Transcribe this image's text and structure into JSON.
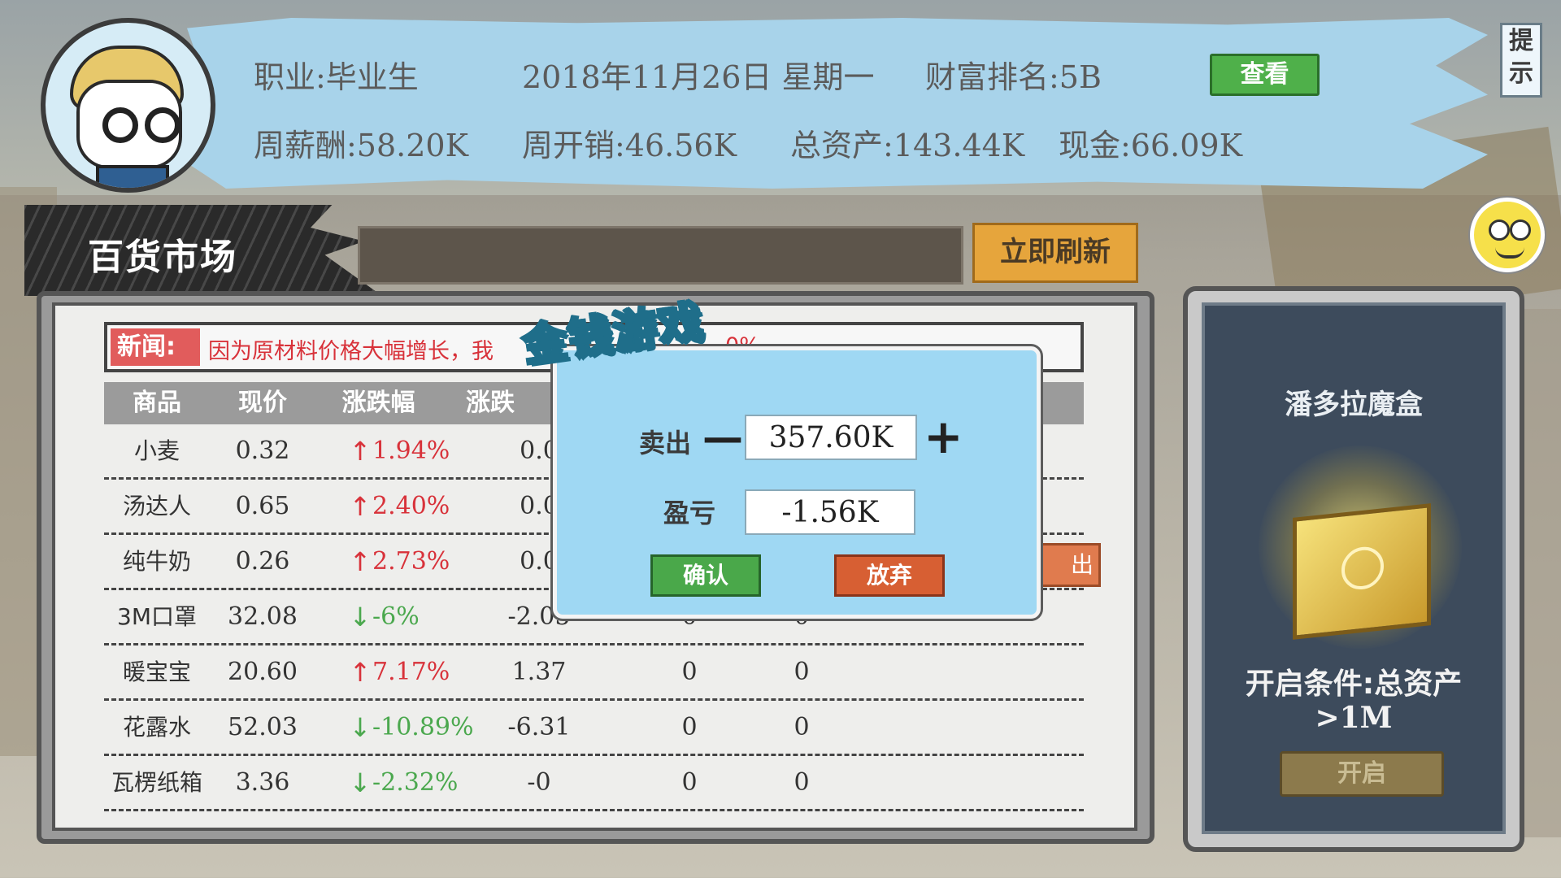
{
  "header": {
    "occupation": "职业:毕业生",
    "date": "2018年11月26日 星期一",
    "wealth_rank": "财富排名:5B",
    "view_label": "查看",
    "weekly_salary": "周薪酬:58.20K",
    "weekly_expense": "周开销:46.56K",
    "total_assets": "总资产:143.44K",
    "cash": "现金:66.09K",
    "hint_label": "提示"
  },
  "market": {
    "title": "百货市场",
    "refresh_label": "立即刷新",
    "news_tag": "新闻:",
    "news_text": "因为原材料价格大幅增长，我",
    "news_tail": "0%",
    "headers": [
      "商品",
      "现价",
      "涨跌幅",
      "涨跌"
    ],
    "rows": [
      {
        "name": "小麦",
        "price": "0.32",
        "dir": "up",
        "arrow": "↑",
        "pct": "1.94%",
        "chg": "0.0",
        "held": "",
        "cost": ""
      },
      {
        "name": "汤达人",
        "price": "0.65",
        "dir": "up",
        "arrow": "↑",
        "pct": "2.40%",
        "chg": "0.0",
        "held": "",
        "cost": ""
      },
      {
        "name": "纯牛奶",
        "price": "0.26",
        "dir": "up",
        "arrow": "↑",
        "pct": "2.73%",
        "chg": "0.0",
        "held": "",
        "cost": ""
      },
      {
        "name": "3M口罩",
        "price": "32.08",
        "dir": "down",
        "arrow": "↓",
        "pct": "-6%",
        "chg": "-2.05",
        "held": "0",
        "cost": "0"
      },
      {
        "name": "暖宝宝",
        "price": "20.60",
        "dir": "up",
        "arrow": "↑",
        "pct": "7.17%",
        "chg": "1.37",
        "held": "0",
        "cost": "0"
      },
      {
        "name": "花露水",
        "price": "52.03",
        "dir": "down",
        "arrow": "↓",
        "pct": "-10.89%",
        "chg": "-6.31",
        "held": "0",
        "cost": "0"
      },
      {
        "name": "瓦楞纸箱",
        "price": "3.36",
        "dir": "down",
        "arrow": "↓",
        "pct": "-2.32%",
        "chg": "-0",
        "held": "0",
        "cost": "0"
      }
    ],
    "sell_stub": "出"
  },
  "pandora": {
    "title": "潘多拉魔盒",
    "condition_line1": "开启条件:总资产",
    "condition_line2": ">1M",
    "open_label": "开启"
  },
  "modal": {
    "logo": "金钱游戏",
    "sell_label": "卖出",
    "minus": "—",
    "plus": "+",
    "sell_value": "357.60K",
    "pnl_label": "盈亏",
    "pnl_value": "-1.56K",
    "confirm_label": "确认",
    "abandon_label": "放弃"
  },
  "colors": {
    "banner": "#a8d3ea",
    "up": "#d8323a",
    "down": "#4ba84e",
    "confirm": "#4aa84a",
    "abandon": "#d75f33",
    "refresh": "#e6a53c"
  }
}
